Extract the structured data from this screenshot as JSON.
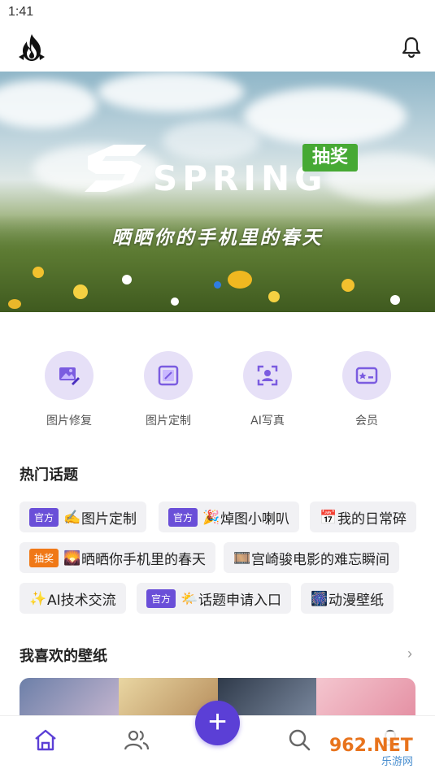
{
  "status_bar": {
    "time": "1:41"
  },
  "header": {
    "logo_icon": "flame-logo-icon",
    "bell_icon": "bell-icon"
  },
  "banner": {
    "logo_text": "SPRING",
    "badge": "抽奖",
    "subtitle": "晒晒你的手机里的春天",
    "dots_count": 1
  },
  "features": [
    {
      "label": "图片修复",
      "icon": "image-repair-icon"
    },
    {
      "label": "图片定制",
      "icon": "image-frame-icon"
    },
    {
      "label": "AI写真",
      "icon": "ai-portrait-icon"
    },
    {
      "label": "会员",
      "icon": "member-card-icon"
    }
  ],
  "hot_topics": {
    "title": "热门话题",
    "items": [
      {
        "tag": "官方",
        "emoji": "✍️",
        "text": "图片定制"
      },
      {
        "tag": "官方",
        "emoji": "🎉",
        "text": "焯图小喇叭"
      },
      {
        "tag": "",
        "emoji": "📅",
        "text": "我的日常碎"
      },
      {
        "tag": "抽奖",
        "emoji": "🌄",
        "text": "晒晒你手机里的春天"
      },
      {
        "tag": "",
        "emoji": "🎞️",
        "text": "宫崎骏电影的难忘瞬间"
      },
      {
        "tag": "",
        "emoji": "✨",
        "text": "AI技术交流"
      },
      {
        "tag": "官方",
        "emoji": "🌤️",
        "text": "话题申请入口"
      },
      {
        "tag": "",
        "emoji": "🎆",
        "text": "动漫壁纸"
      }
    ]
  },
  "favorites": {
    "title": "我喜欢的壁纸",
    "more": "›"
  },
  "bottom_nav": {
    "home_icon": "home-icon",
    "community_icon": "users-icon",
    "add_icon": "plus-icon",
    "add_label": "+",
    "search_icon": "search-icon",
    "profile_icon": "profile-icon"
  },
  "watermark": {
    "text": "962.NET",
    "subtext": "乐游网"
  },
  "colors": {
    "accent": "#5b3fd6",
    "chip_bg": "#f1f1f4",
    "feature_bg": "#e6e0f7",
    "lottery_green": "#46a934",
    "lottery_orange": "#f07817"
  }
}
